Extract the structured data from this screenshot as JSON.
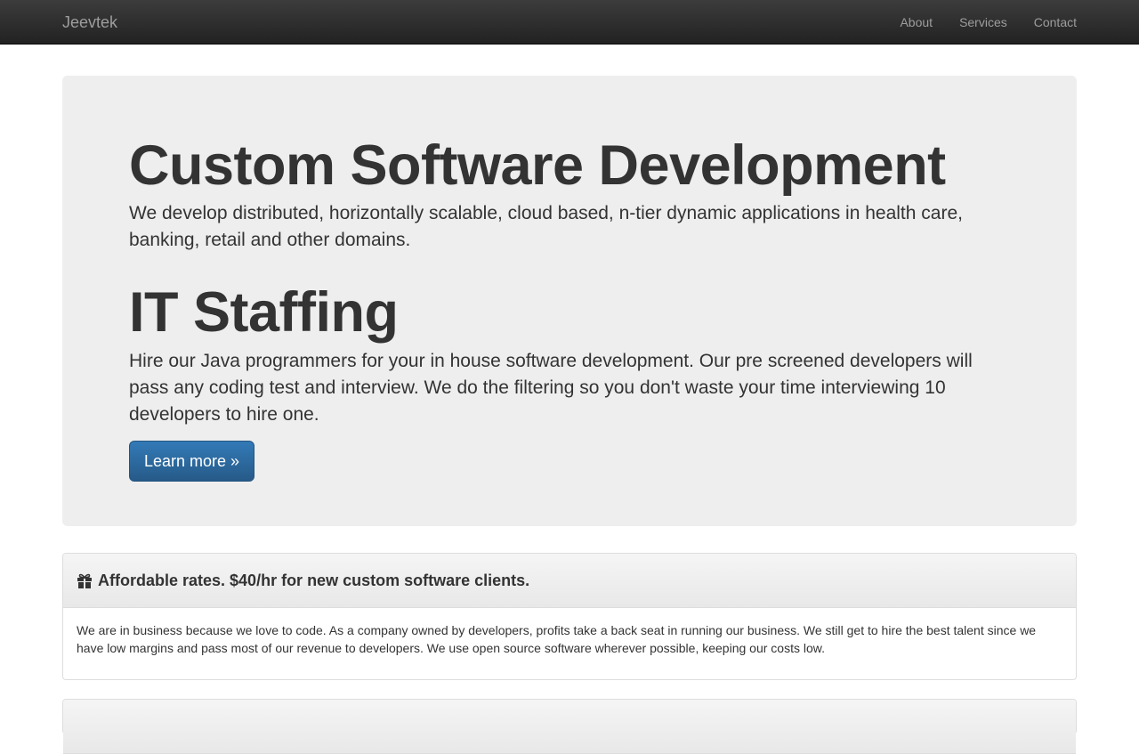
{
  "navbar": {
    "brand": "Jeevtek",
    "links": [
      "About",
      "Services",
      "Contact"
    ]
  },
  "jumbotron": {
    "heading1": "Custom Software Development",
    "paragraph1": "We develop distributed, horizontally scalable, cloud based, n-tier dynamic applications in health care, banking, retail and other domains.",
    "heading2": "IT Staffing",
    "paragraph2": "Hire our Java programmers for your in house software development. Our pre screened developers will pass any coding test and interview. We do the filtering so you don't waste your time interviewing 10 developers to hire one.",
    "button_label": "Learn more »"
  },
  "panels": [
    {
      "icon": "gift-icon",
      "title": "Affordable rates. $40/hr for new custom software clients.",
      "body": "We are in business because we love to code. As a company owned by developers, profits take a back seat in running our business. We still get to hire the best talent since we have low margins and pass most of our revenue to developers. We use open source software wherever possible, keeping our costs low."
    }
  ],
  "colors": {
    "navbar": "#222222",
    "jumbotron_bg": "#eeeeee",
    "primary_button": "#337ab7"
  }
}
